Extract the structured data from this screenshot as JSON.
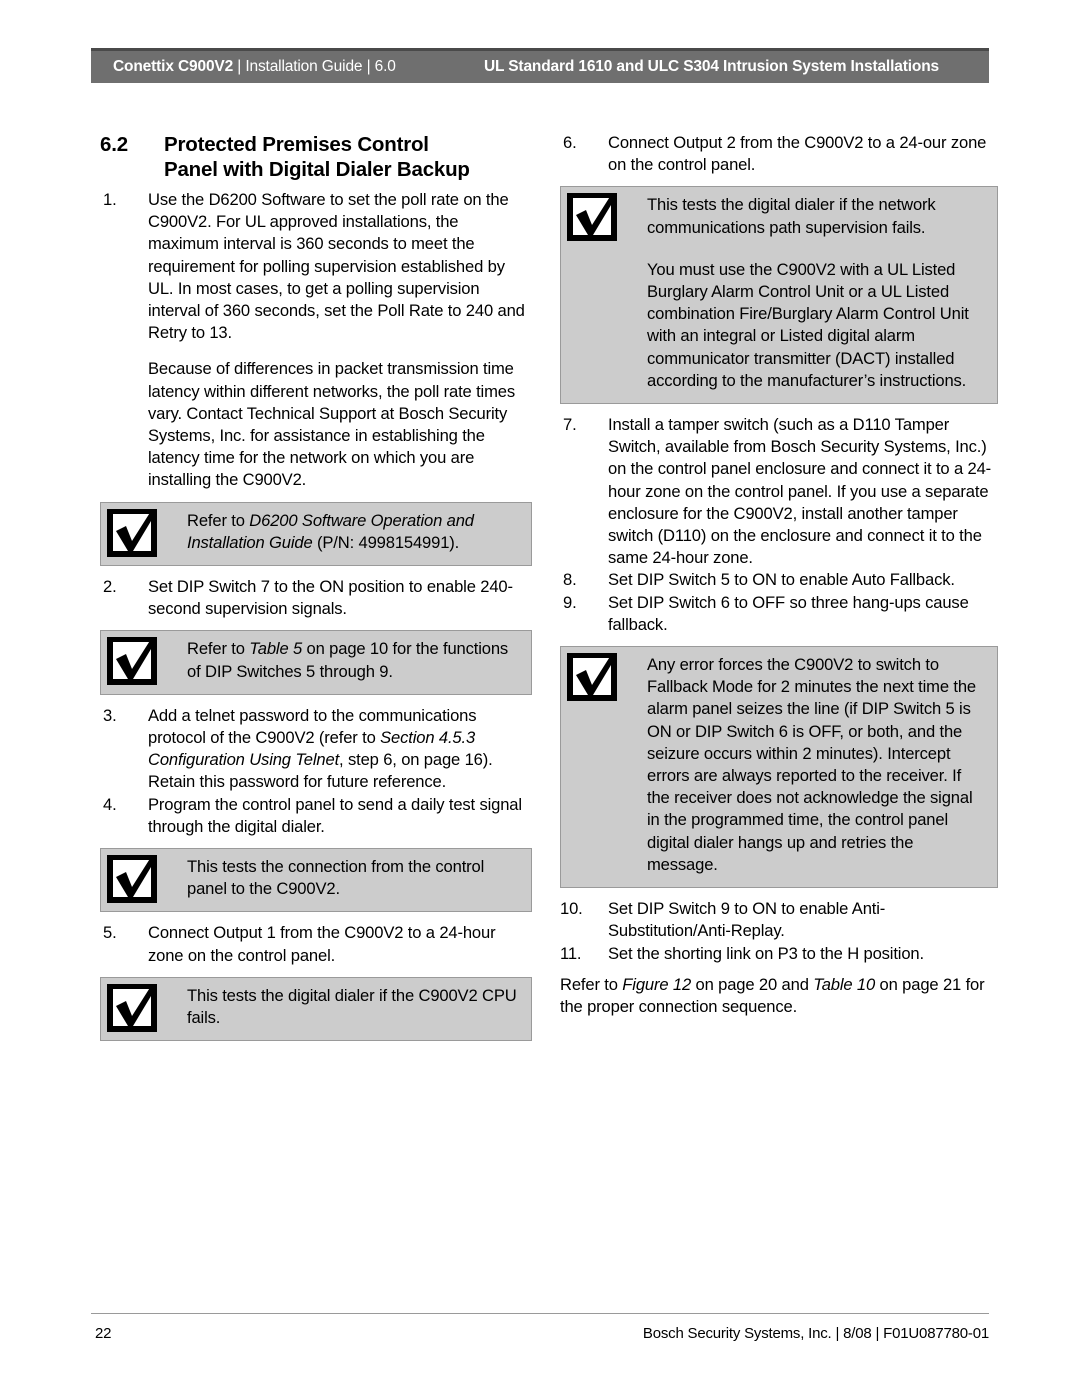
{
  "header": {
    "product": "Conettix C900V2",
    "sep": "|",
    "doc_type": "Installation Guide",
    "version": "6.0",
    "right_title": "UL Standard 1610 and ULC S304 Intrusion System Installations"
  },
  "section": {
    "number": "6.2",
    "title_line1": "Protected Premises Control",
    "title_line2": "Panel with Digital Dialer Backup"
  },
  "left_column": {
    "step1_num": "1.",
    "step1_text": "Use the D6200 Software to set the poll rate on the C900V2. For UL approved installations, the maximum interval is 360 seconds to meet the requirement for polling supervision established by UL. In most cases, to get a polling supervision interval of 360 seconds, set the Poll Rate to 240 and Retry to 13.",
    "step1_para2": "Because of differences in packet transmission time latency within different networks, the poll rate times vary. Contact Technical Support at Bosch Security Systems, Inc. for assistance in establishing the latency time for the network on which you are installing the C900V2.",
    "note1_pre": "Refer to ",
    "note1_ital": "D6200 Software Operation and Installation Guide",
    "note1_post": " (P/N: 4998154991).",
    "step2_num": "2.",
    "step2_text": "Set DIP Switch 7 to the ON position to enable 240-second supervision signals.",
    "note2_pre": "Refer to ",
    "note2_ital": "Table 5",
    "note2_post": " on page 10 for the functions of DIP Switches 5 through 9.",
    "step3_num": "3.",
    "step3_a": "Add a telnet password to the communications protocol of the C900V2 (refer to ",
    "step3_ital1": "Section 4.5.3 Configuration Using Telnet",
    "step3_b": ", step 6, on page 16). Retain this password for future reference.",
    "step4_num": "4.",
    "step4_text": "Program the control panel to send a daily test signal through the digital dialer.",
    "note3_text": "This tests the connection from the control panel to the C900V2.",
    "step5_num": "5.",
    "step5_text": "Connect Output 1 from the C900V2 to a 24-hour zone on the control panel.",
    "note4_text": "This tests the digital dialer if the C900V2 CPU fails."
  },
  "right_column": {
    "step6_num": "6.",
    "step6_text": "Connect Output 2 from the C900V2 to a 24-our zone on the control panel.",
    "note5_text1": "This tests the digital dialer if the network communications path supervision fails.",
    "note5_text2": "You must use the C900V2 with a UL Listed Burglary Alarm Control Unit or a UL Listed combination Fire/Burglary Alarm Control Unit with an integral or Listed digital alarm communicator transmitter (DACT) installed according to the manufacturer’s instructions.",
    "step7_num": "7.",
    "step7_text": "Install a tamper switch (such as a D110 Tamper Switch, available from Bosch Security Systems, Inc.) on the control panel enclosure and connect it to a 24-hour zone on the control panel. If you use a separate enclosure for the C900V2, install another tamper switch (D110) on the enclosure and connect it to the same 24-hour zone.",
    "step8_num": "8.",
    "step8_text": "Set DIP Switch 5 to ON to enable Auto Fallback.",
    "step9_num": "9.",
    "step9_text": "Set DIP Switch 6 to OFF so three hang-ups cause fallback.",
    "note6_text": "Any error forces the C900V2 to switch to Fallback Mode for 2 minutes the next time the alarm panel seizes the line (if DIP Switch 5 is ON or DIP Switch 6 is OFF, or both, and the seizure occurs within 2 minutes). Intercept errors are always reported to the receiver. If the receiver does not acknowledge the signal in the programmed time, the control panel digital dialer hangs up and retries the message.",
    "step10_num": "10.",
    "step10_text": "Set DIP Switch 9 to ON to enable Anti-Substitution/Anti-Replay.",
    "step11_num": "11.",
    "step11_text": "Set the shorting link on P3 to the H position.",
    "closing_pre": "Refer to ",
    "closing_ital1": "Figure 12",
    "closing_mid": " on page 20 and ",
    "closing_ital2": "Table 10",
    "closing_post": " on page 21 for the proper connection sequence."
  },
  "footer": {
    "page_number": "22",
    "info": "Bosch Security Systems, Inc. | 8/08 | F01U087780-01"
  },
  "icons": {
    "note_icon": "checkmark-box-icon"
  },
  "colors": {
    "header_bar": "#6f6f6f",
    "header_bar_top": "#4a4a4a",
    "note_fill": "#cccccc",
    "note_border": "#9a9a9a",
    "text": "#000000"
  }
}
